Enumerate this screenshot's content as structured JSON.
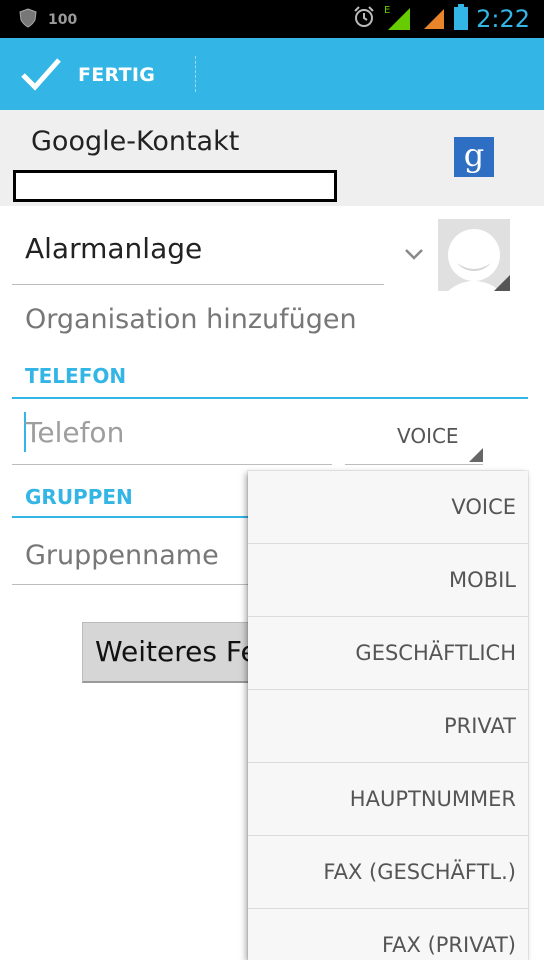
{
  "status_bar": {
    "battery_level": "100",
    "time": "2:22",
    "network_type": "E"
  },
  "action_bar": {
    "done_label": "FERTIG"
  },
  "account": {
    "title": "Google-Kontakt",
    "logo_letter": "g"
  },
  "contact": {
    "name_value": "Alarmanlage",
    "add_organization": "Organisation hinzufügen"
  },
  "sections": {
    "phone_header": "TELEFON",
    "phone_placeholder": "Telefon",
    "phone_type": "VOICE",
    "groups_header": "GRUPPEN",
    "group_placeholder": "Gruppenname"
  },
  "more_button": "Weiteres Feld",
  "type_menu": {
    "items": [
      "VOICE",
      "MOBIL",
      "GESCHÄFTLICH",
      "PRIVAT",
      "HAUPTNUMMER",
      "FAX (GESCHÄFTL.)",
      "FAX (PRIVAT)"
    ]
  },
  "colors": {
    "accent": "#33b5e5",
    "action_bar": "#33b5e5",
    "google_logo": "#2e6fc4"
  }
}
